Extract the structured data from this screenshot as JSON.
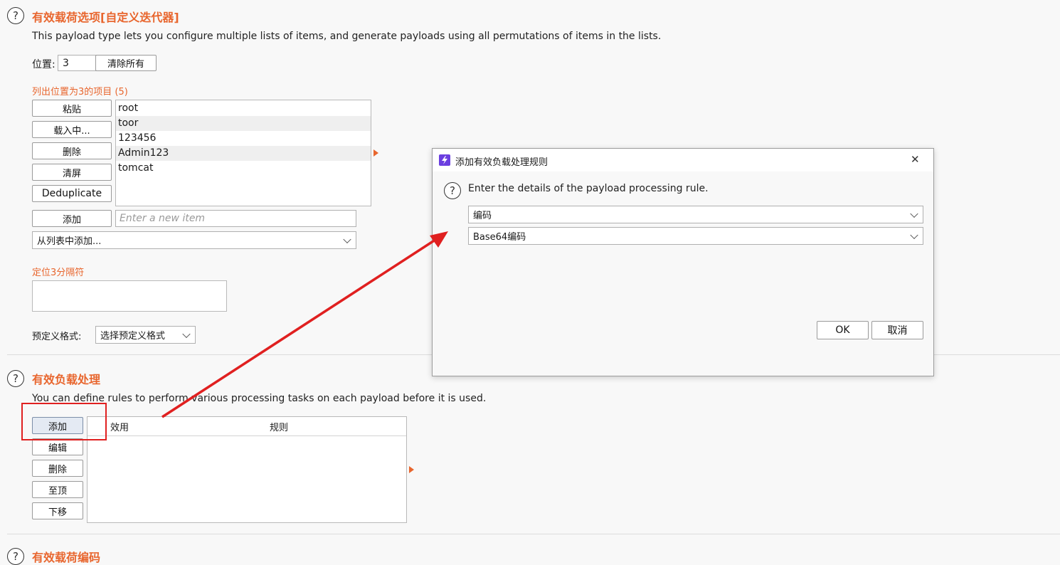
{
  "payload_options": {
    "title": "有效载荷选项[自定义迭代器]",
    "description": "This payload type lets you configure multiple lists of items, and generate payloads using all permutations of items in the lists.",
    "position_label": "位置:",
    "position_value": "3",
    "clear_all": "清除所有",
    "list_label": "列出位置为3的项目 (5)",
    "buttons": {
      "paste": "粘贴",
      "load": "载入中...",
      "remove": "删除",
      "clear": "清屏",
      "deduplicate": "Deduplicate",
      "add": "添加"
    },
    "items": [
      "root",
      "toor",
      "123456",
      "Admin123",
      "tomcat"
    ],
    "new_item_placeholder": "Enter a new item",
    "add_from_list": "从列表中添加...",
    "separator_label": "定位3分隔符",
    "predefined_label": "预定义格式:",
    "predefined_select": "选择预定义格式"
  },
  "processing": {
    "title": "有效负载处理",
    "description": "You can define rules to perform various processing tasks on each payload before it is used.",
    "buttons": {
      "add": "添加",
      "edit": "编辑",
      "remove": "删除",
      "up": "至顶",
      "down": "下移"
    },
    "columns": [
      "效用",
      "规则"
    ]
  },
  "next_section_title": "有效载荷编码",
  "dialog": {
    "title": "添加有效负载处理规则",
    "prompt": "Enter the details of the payload processing rule.",
    "rule_type": "编码",
    "rule_value": "Base64编码",
    "ok": "OK",
    "cancel": "取消",
    "close_glyph": "✕"
  },
  "icons": {
    "help": "?",
    "app": "burp-lightning-icon"
  },
  "colors": {
    "accent": "#e8662e",
    "annotation": "#e02020"
  }
}
